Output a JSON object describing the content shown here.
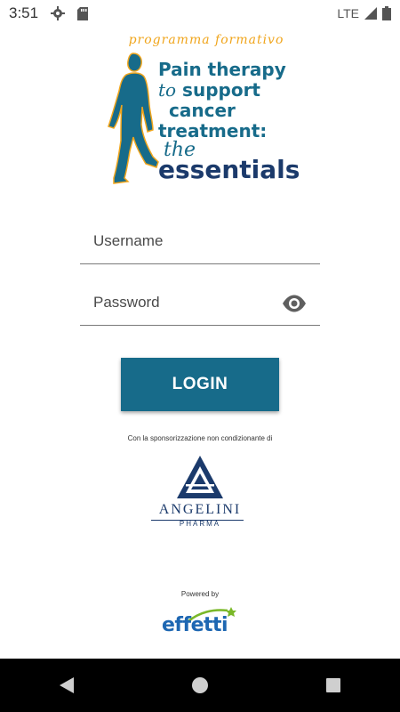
{
  "status_bar": {
    "time": "3:51",
    "network": "LTE",
    "icons": [
      "settings-icon",
      "sd-card-icon",
      "signal-icon",
      "battery-icon"
    ]
  },
  "logo": {
    "subtitle": "programma formativo",
    "title_line1": "Pain therapy",
    "title_script_to": "to",
    "title_line2": "support",
    "title_line3": "cancer",
    "title_line4": "treatment:",
    "title_script_the": "the",
    "title_line5": "essentials"
  },
  "form": {
    "username_placeholder": "Username",
    "password_placeholder": "Password",
    "login_label": "LOGIN"
  },
  "sponsor": {
    "text": "Con la sponsorizzazione non condizionante di",
    "company": "ANGELINI",
    "division": "PHARMA"
  },
  "powered": {
    "text": "Powered by",
    "brand": "effetti"
  },
  "colors": {
    "primary": "#176b8a",
    "navy": "#1b3a6b",
    "accent_orange": "#f0a51c",
    "effetti_blue": "#1e67b2",
    "effetti_green": "#7ab828"
  },
  "nav_bar": {
    "icons": [
      "back-icon",
      "home-icon",
      "recents-icon"
    ]
  }
}
